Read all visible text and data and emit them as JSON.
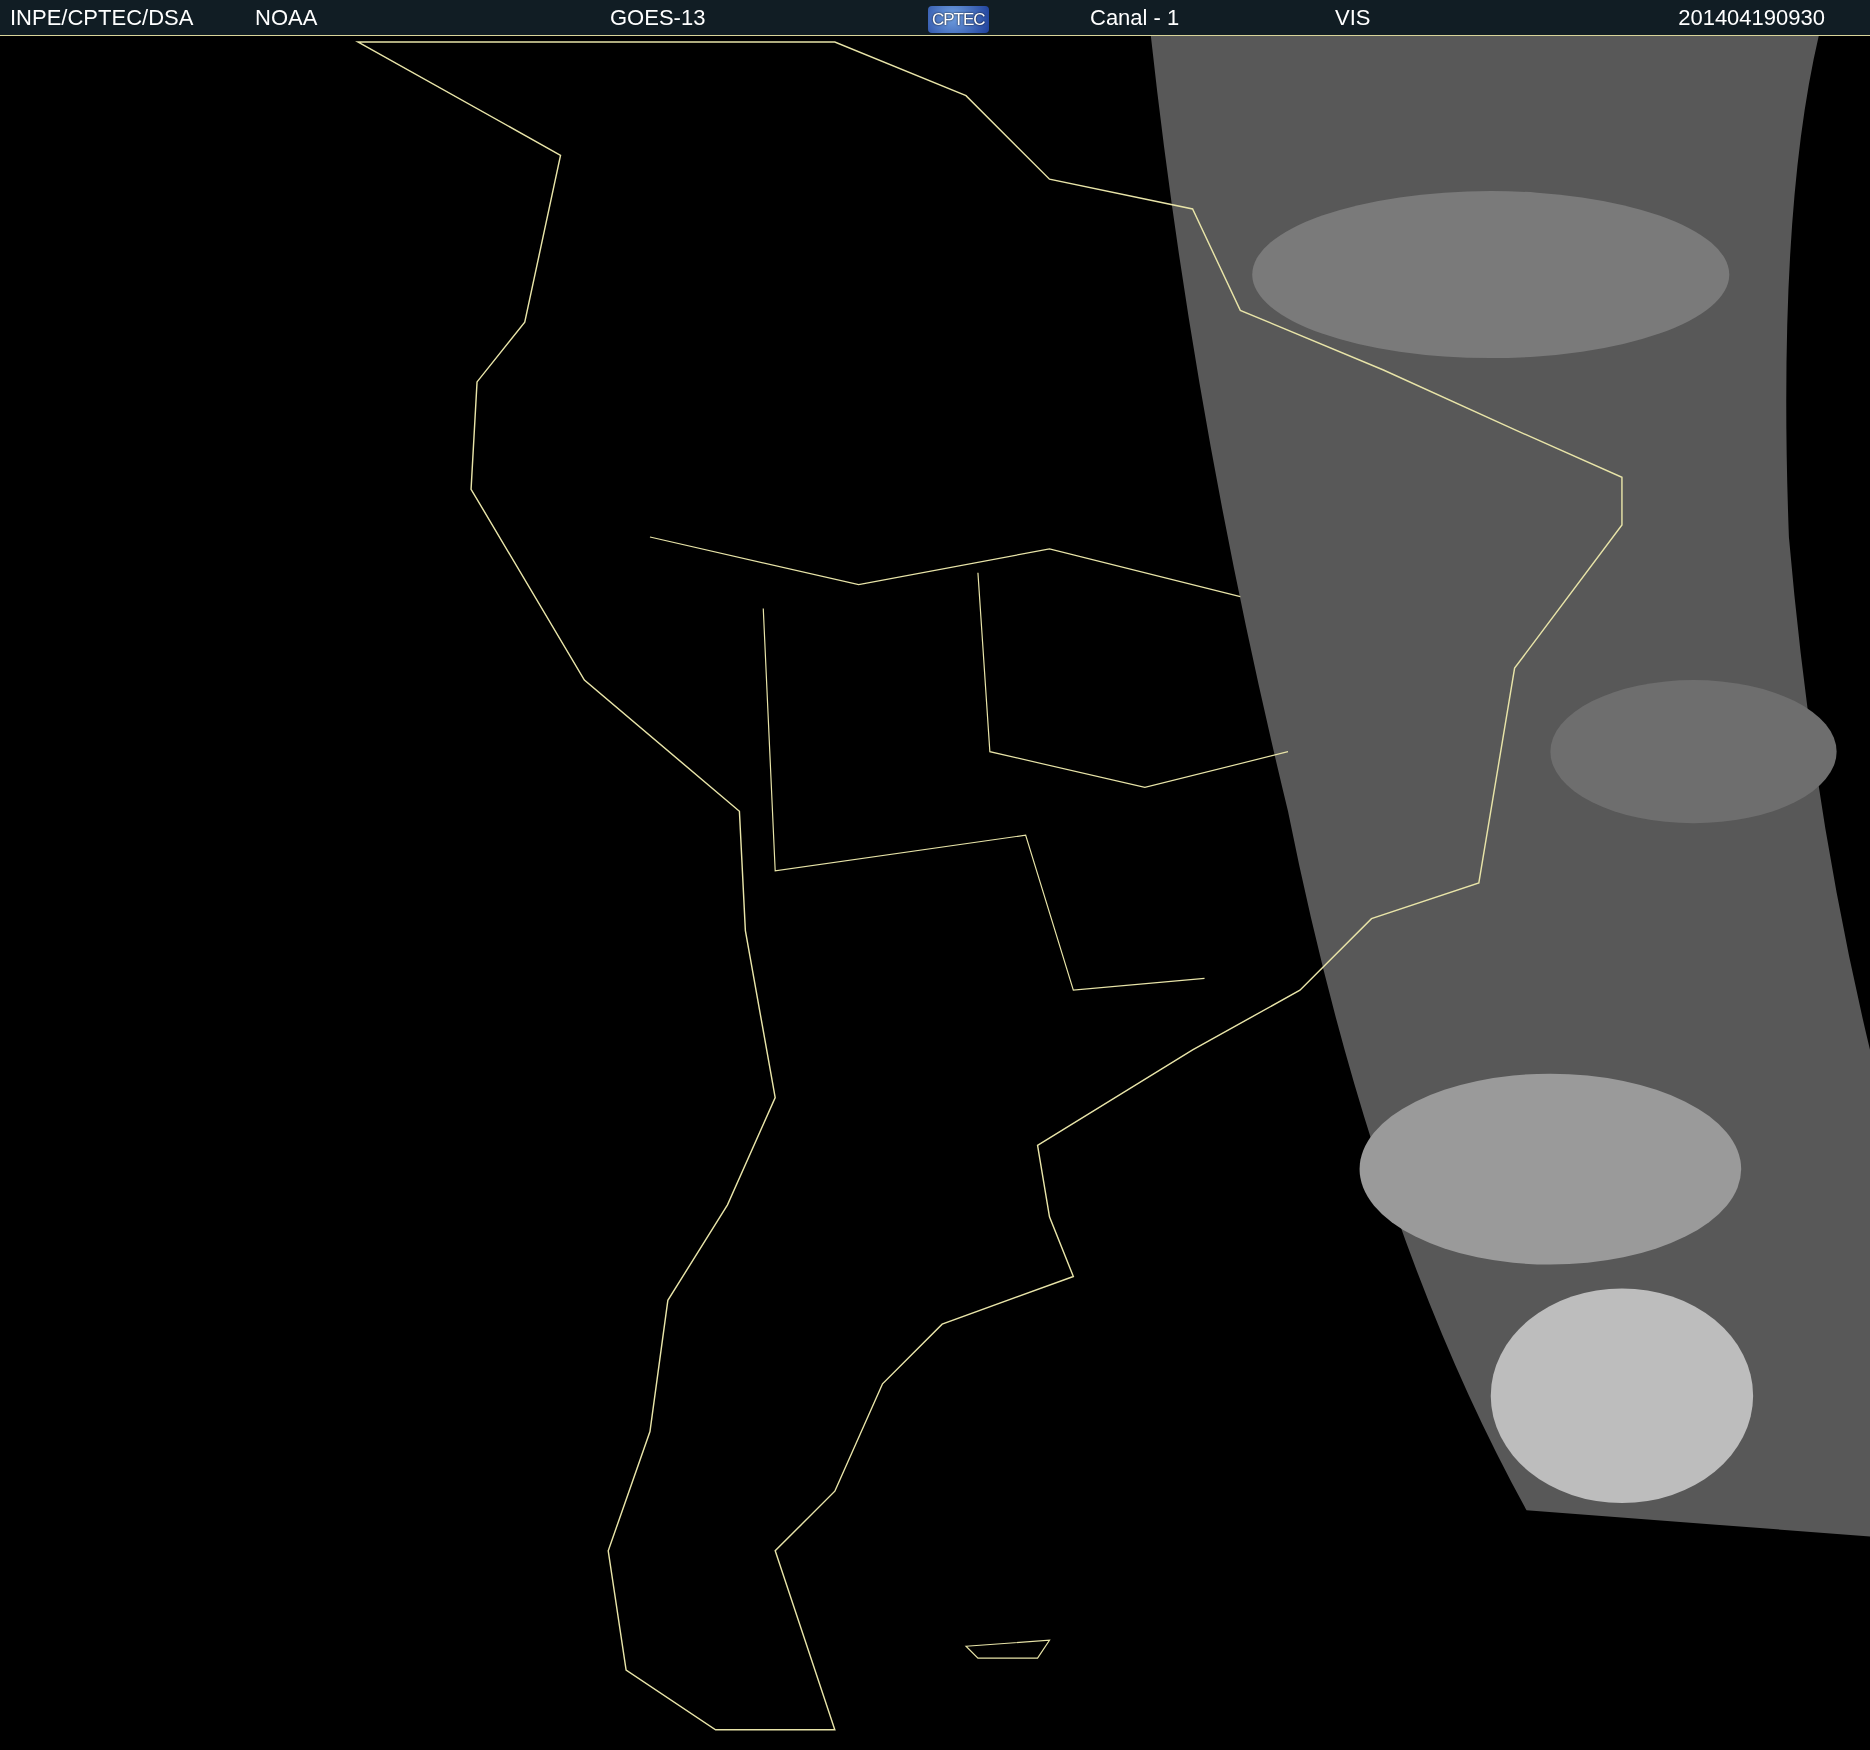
{
  "header": {
    "items": [
      {
        "kind": "text",
        "text": "INPE/CPTEC/DSA"
      },
      {
        "kind": "text",
        "text": "NOAA"
      },
      {
        "kind": "text",
        "text": "GOES-13"
      },
      {
        "kind": "logo",
        "text": "CPTEC"
      },
      {
        "kind": "text",
        "text": "Canal - 1"
      },
      {
        "kind": "text",
        "text": "VIS"
      },
      {
        "kind": "text",
        "text": "201404190930"
      }
    ]
  }
}
